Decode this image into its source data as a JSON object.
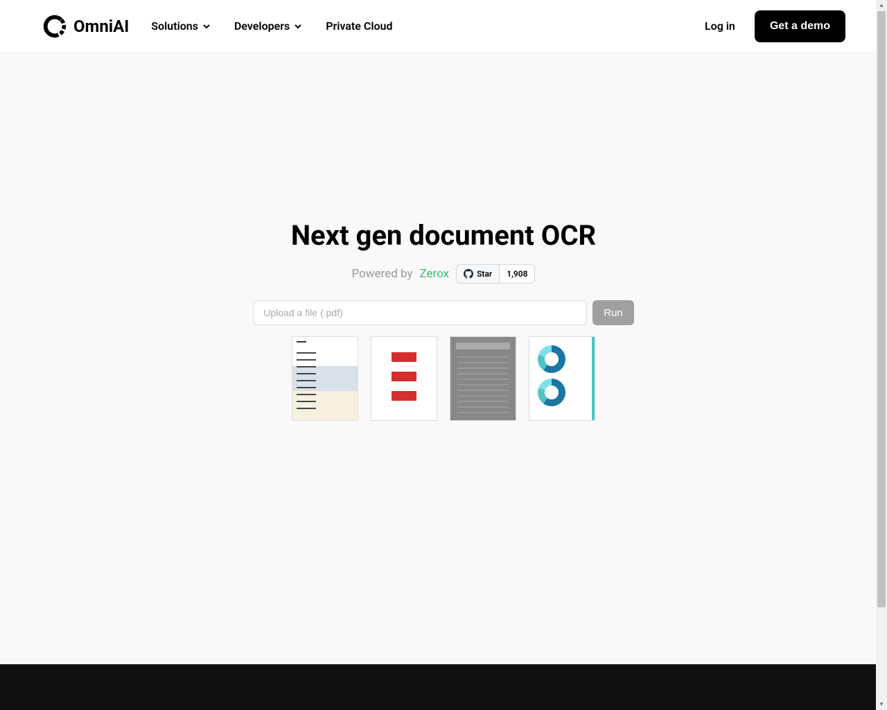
{
  "brand": "OmniAI",
  "nav": {
    "solutions": "Solutions",
    "developers": "Developers",
    "private_cloud": "Private Cloud"
  },
  "auth": {
    "login": "Log in",
    "demo": "Get a demo"
  },
  "hero": {
    "title": "Next gen document OCR",
    "powered_by": "Powered by",
    "zerox": "Zerox"
  },
  "github": {
    "star_label": "Star",
    "count": "1,908"
  },
  "upload": {
    "placeholder": "Upload a file (.pdf)",
    "run_label": "Run"
  }
}
